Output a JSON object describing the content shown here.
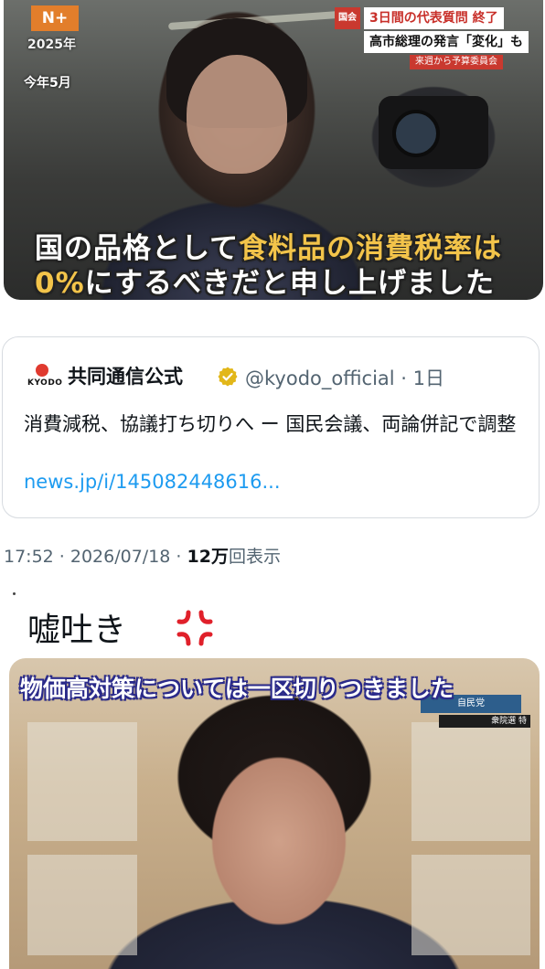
{
  "video1": {
    "logo_text": "N+",
    "year_label": "2025年",
    "month_label": "今年5月",
    "ticker": {
      "tag": "国会",
      "line1": "3日間の代表質問 終了",
      "line2": "高市総理の発言「変化」も",
      "line3": "来週から予算委員会"
    },
    "subtitle": {
      "line1_pre": "国の品格として",
      "line1_highlight": "食料品の消費税率は",
      "line2_highlight": "0%",
      "line2_post": "にするべきだと申し上げました"
    }
  },
  "quote_card": {
    "logo_text": "KYODO",
    "display_name": "共同通信公式",
    "handle_time": "@kyodo_official · 1日",
    "text": "消費減税、協議打ち切りへ ー 国民会議、両論併記で調整",
    "link": "news.jp/i/145082448616..."
  },
  "meta": {
    "timestamp": "17:52 · 2026/07/18 · ",
    "views_count": "12万",
    "views_label": "回表示"
  },
  "caption": {
    "text": "嘘吐き",
    "emoji_icon": "anger-symbol-icon"
  },
  "video2": {
    "subtitle": "物価高対策については一区切りつきました",
    "badge": "自民党",
    "badge2": "衆院選 特"
  },
  "colors": {
    "link": "#1d9bf0",
    "secondary_text": "#536471",
    "highlight_subtitle": "#f3c44a",
    "ticker_red": "#c9392f",
    "logo_orange": "#e27e2b"
  }
}
